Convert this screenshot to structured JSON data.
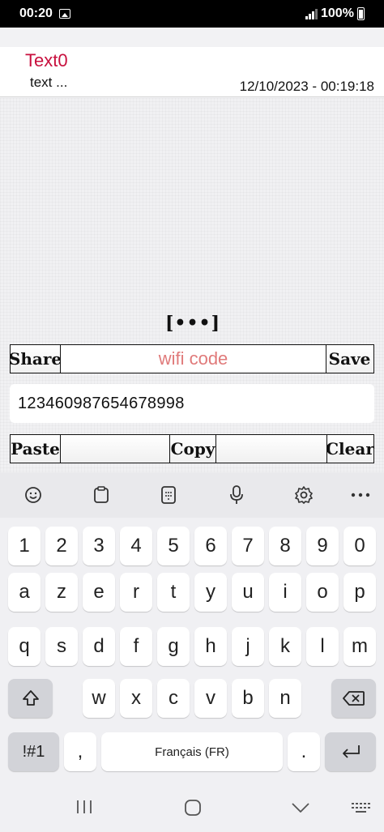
{
  "status": {
    "time": "00:20",
    "battery": "100%"
  },
  "header": {
    "title": "Text0",
    "subtitle": "text ...",
    "date": "12/10/2023 - 00:19:18"
  },
  "main": {
    "dots_label": "[•••]",
    "share_label": "Share",
    "field_label": "wifi code",
    "save_label": "Save",
    "text_value": "123460987654678998",
    "paste_label": "Paste",
    "copy_label": "Copy",
    "clear_label": "Clear"
  },
  "keyboard": {
    "toolbar": [
      "emoji-icon",
      "clipboard-icon",
      "keypad-icon",
      "microphone-icon",
      "settings-icon",
      "more-icon"
    ],
    "row_numbers": [
      "1",
      "2",
      "3",
      "4",
      "5",
      "6",
      "7",
      "8",
      "9",
      "0"
    ],
    "row_1": [
      "a",
      "z",
      "e",
      "r",
      "t",
      "y",
      "u",
      "i",
      "o",
      "p"
    ],
    "row_2": [
      "q",
      "s",
      "d",
      "f",
      "g",
      "h",
      "j",
      "k",
      "l",
      "m"
    ],
    "row_3": [
      "w",
      "x",
      "c",
      "v",
      "b",
      "n"
    ],
    "symbols_label": "!#1",
    "comma_label": ",",
    "space_label": "Français (FR)",
    "period_label": "."
  }
}
